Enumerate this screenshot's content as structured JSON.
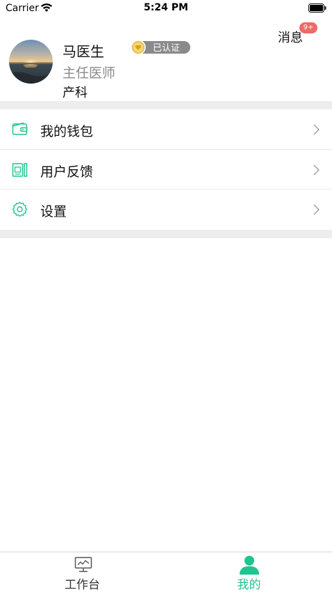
{
  "status_bar": {
    "carrier": "Carrier",
    "time": "5:24 PM"
  },
  "profile": {
    "name": "马医生",
    "verified_label": "已认证",
    "title": "主任医师",
    "department": "产科"
  },
  "messages": {
    "label": "消息",
    "badge": "9+"
  },
  "menu": {
    "items": [
      {
        "label": "我的钱包",
        "icon": "wallet-icon"
      },
      {
        "label": "用户反馈",
        "icon": "feedback-icon"
      },
      {
        "label": "设置",
        "icon": "gear-icon"
      }
    ]
  },
  "tab_bar": {
    "tabs": [
      {
        "label": "工作台",
        "icon": "monitor-chart-icon",
        "active": false
      },
      {
        "label": "我的",
        "icon": "person-icon",
        "active": true
      }
    ]
  },
  "colors": {
    "accent": "#1fc48f",
    "badge_red": "#f06a6a",
    "band_gray": "#ededed"
  }
}
